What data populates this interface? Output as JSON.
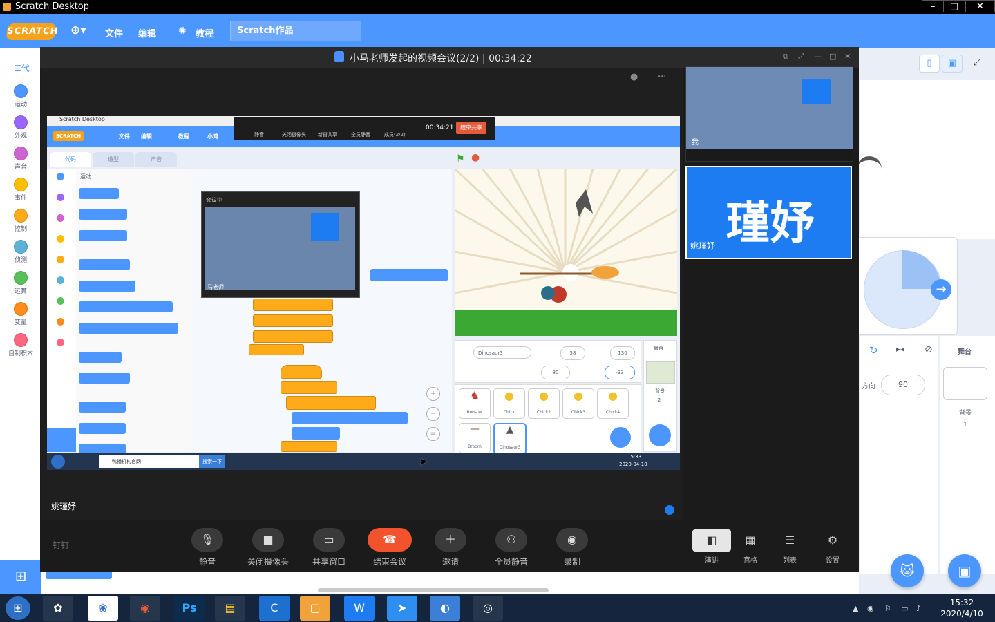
{
  "window": {
    "title": "Scratch Desktop",
    "controls": [
      "–",
      "□",
      "✕"
    ]
  },
  "menubar": {
    "logo": "SCRATCH",
    "globe_icon": "globe-icon",
    "file": "文件",
    "edit": "编辑",
    "tutorials": "教程",
    "project_title": "Scratch作品"
  },
  "categories": [
    {
      "label": "运动",
      "color": "#4c97ff"
    },
    {
      "label": "外观",
      "color": "#9966ff"
    },
    {
      "label": "声音",
      "color": "#cf63cf"
    },
    {
      "label": "事件",
      "color": "#ffbf00"
    },
    {
      "label": "控制",
      "color": "#ffab19"
    },
    {
      "label": "侦测",
      "color": "#5cb1d6"
    },
    {
      "label": "运算",
      "color": "#59c059"
    },
    {
      "label": "变量",
      "color": "#ff8c1a"
    },
    {
      "label": "自制积木",
      "color": "#ff6680"
    }
  ],
  "code_tab_partial": "代",
  "stage_side": {
    "direction_label": "方向",
    "direction_value": "90",
    "stage_label": "舞台",
    "backdrop_label": "背景",
    "backdrop_count": "1"
  },
  "meeting": {
    "title": "小马老师发起的视频会议(2/2) | 00:34:22",
    "speaker_name": "姚瑾妤",
    "participant_big_text": "瑾妤",
    "participant_name": "姚瑾妤",
    "thumb1_label": "我",
    "brand": "钉钉",
    "controls": [
      {
        "label": "静音",
        "icon": "microphone-icon"
      },
      {
        "label": "关闭摄像头",
        "icon": "camera-icon"
      },
      {
        "label": "共享窗口",
        "icon": "share-window-icon"
      },
      {
        "label": "结束会议",
        "icon": "hang-up-icon"
      },
      {
        "label": "邀请",
        "icon": "invite-icon"
      },
      {
        "label": "全员静音",
        "icon": "mute-all-icon"
      },
      {
        "label": "录制",
        "icon": "record-icon"
      }
    ],
    "views": [
      {
        "label": "演讲",
        "icon": "speaker-view-icon"
      },
      {
        "label": "宫格",
        "icon": "grid-view-icon"
      },
      {
        "label": "列表",
        "icon": "list-view-icon"
      },
      {
        "label": "设置",
        "icon": "settings-icon"
      }
    ]
  },
  "shared": {
    "title": "Scratch Desktop",
    "menu": [
      "文件",
      "编辑",
      "教程",
      "小鸡"
    ],
    "toolbar": [
      "静音",
      "关闭摄像头",
      "新窗共享",
      "全员静音",
      "成员(2/2)"
    ],
    "timer": "00:34:21",
    "end_share": "结束共享",
    "tabs": [
      "代码",
      "造型",
      "声音"
    ],
    "category_title": "运动",
    "embed_title": "会议中",
    "embed_name": "马老师",
    "sprite_name": "Dinosaur3",
    "x": "58",
    "y": "130",
    "size": "80",
    "direction": "-33",
    "sprites": [
      "Rooster",
      "Chick",
      "Chick2",
      "Chick3",
      "Chick4",
      "Broom",
      "Dinosaur3"
    ],
    "stage_label": "舞台",
    "backdrop_label": "背景",
    "backdrop_count": "2",
    "taskbar_search": "鸭播机构官网",
    "taskbar_search_btn": "搜索一下",
    "taskbar_time": "15:33",
    "taskbar_date": "2020-04-10"
  },
  "taskbar": {
    "time": "15:32",
    "date": "2020/4/10"
  }
}
